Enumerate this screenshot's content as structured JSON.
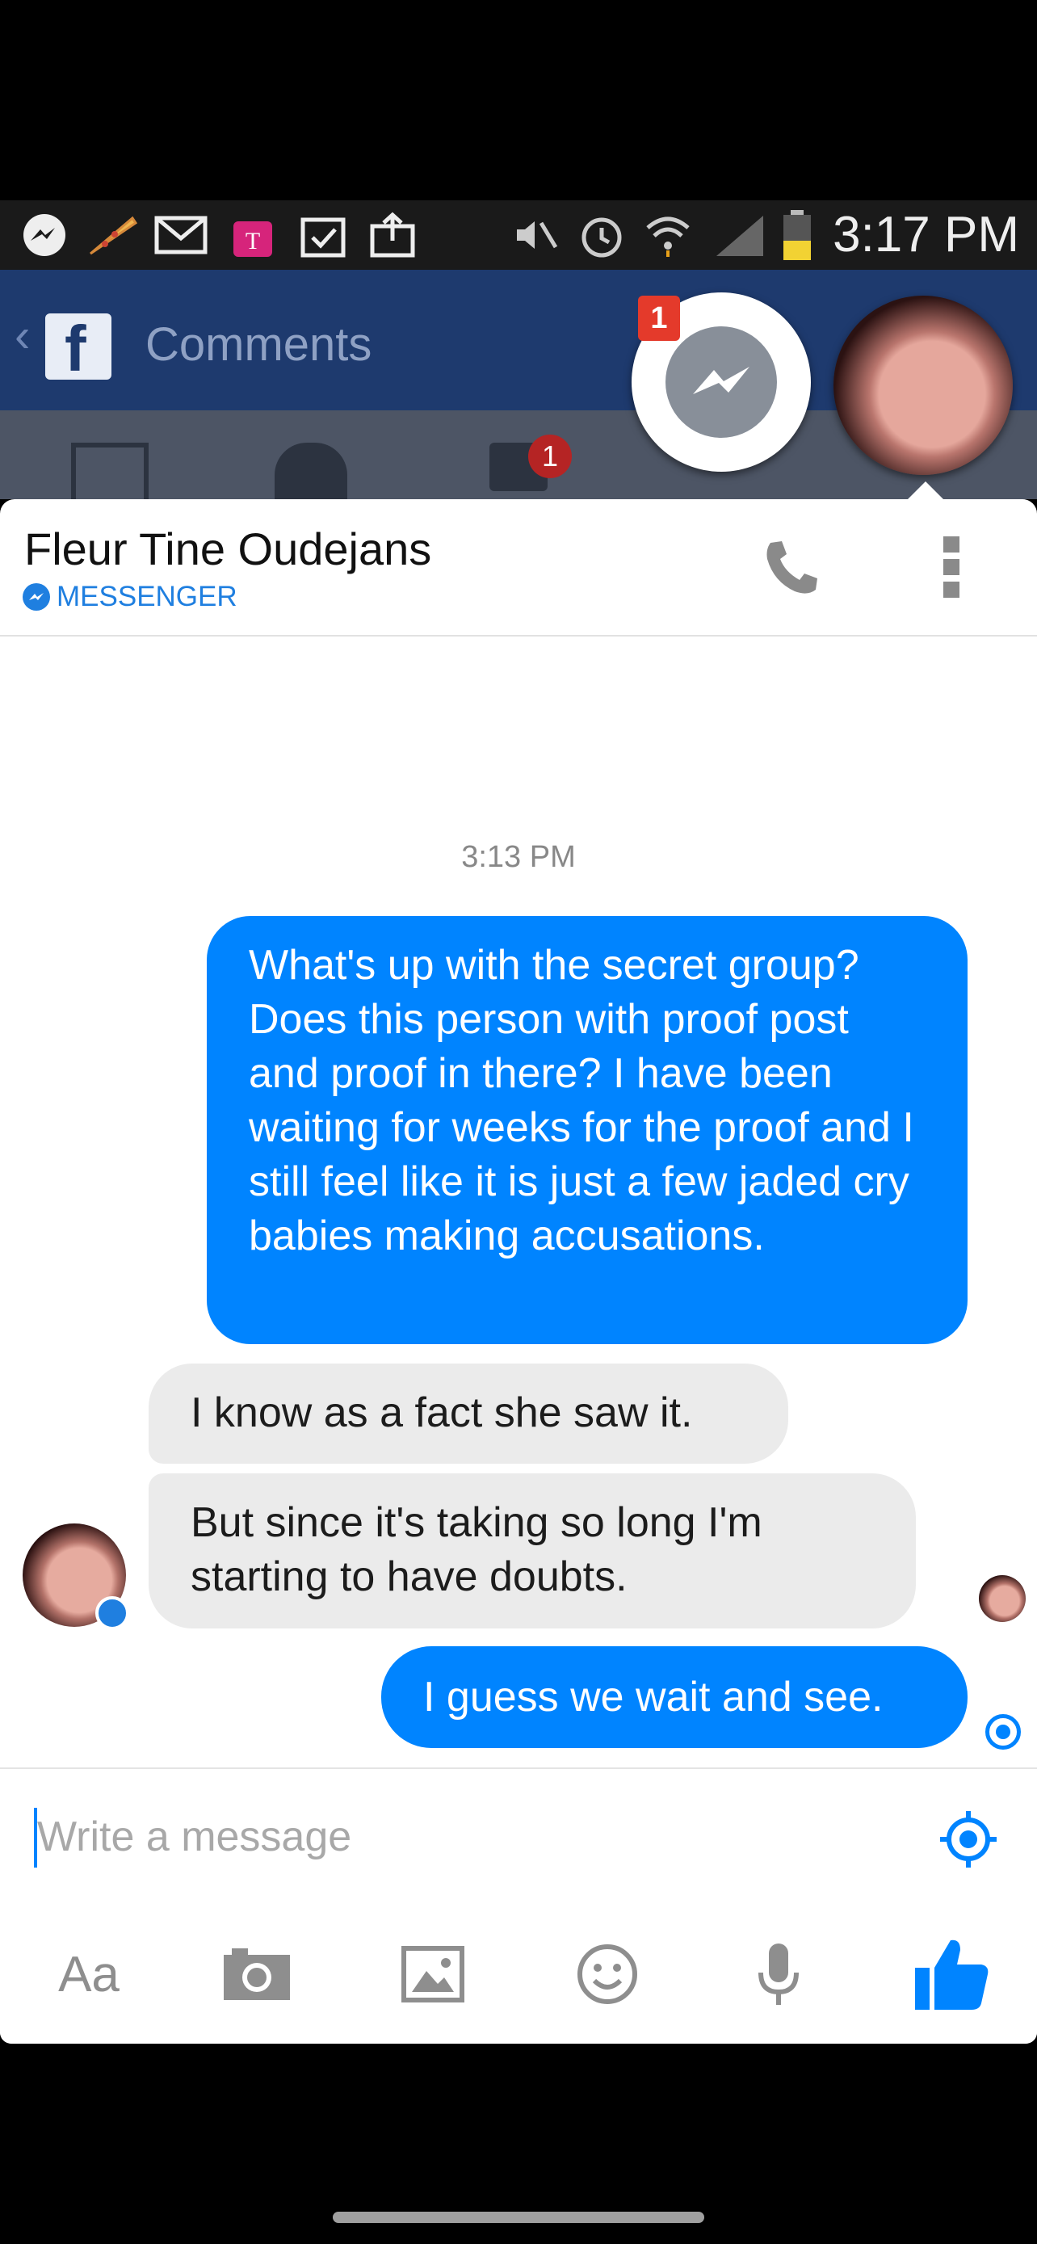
{
  "status_bar": {
    "time": "3:17 PM",
    "carrier_logo_text": "T",
    "icons": [
      "messenger-icon",
      "pizza-icon",
      "mail-icon",
      "tmobile-icon",
      "clipboard-check-icon",
      "upload-icon",
      "mute-icon",
      "alarm-icon",
      "wifi-icon",
      "signal-icon",
      "battery-icon"
    ]
  },
  "background_app": {
    "back_glyph": "‹",
    "logo_letter": "f",
    "title": "Comments",
    "notification_count": "1"
  },
  "chat_head": {
    "badge_count": "1"
  },
  "chat": {
    "contact_name": "Fleur Tine Oudejans",
    "source_label": "MESSENGER",
    "timestamp": "3:13 PM",
    "messages": [
      {
        "direction": "outgoing",
        "text": "What's up with the secret group? Does this person with proof post and proof in there? I have been waiting for weeks for the proof and I still feel like it is just a few jaded cry babies making accusations."
      },
      {
        "direction": "incoming",
        "text": "I know as a fact she saw it."
      },
      {
        "direction": "incoming",
        "text": "But since it's taking so long I'm starting to have doubts."
      },
      {
        "direction": "outgoing",
        "text": "I guess we wait and see."
      }
    ]
  },
  "composer": {
    "placeholder": "Write a message",
    "value": ""
  },
  "toolbar": {
    "text_label": "Aa",
    "items": [
      "text-format",
      "camera-icon",
      "gallery-icon",
      "emoji-icon",
      "microphone-icon",
      "thumbs-up-icon"
    ]
  },
  "colors": {
    "accent": "#0084ff",
    "incoming_bubble": "#ebebeb",
    "fb_header": "#1e3a6e"
  }
}
